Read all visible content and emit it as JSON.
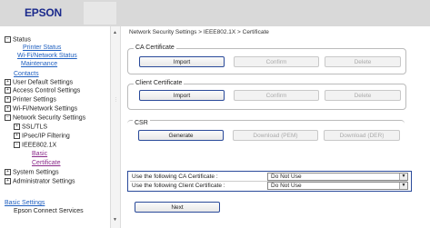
{
  "header": {
    "logo": "EPSON"
  },
  "sidebar": {
    "status": "Status",
    "printer_status": "Printer Status",
    "wifi_status": "Wi-Fi/Network Status",
    "maintenance": "Maintenance",
    "contacts": "Contacts",
    "user_default": "User Default Settings",
    "access_control": "Access Control Settings",
    "printer_settings": "Printer Settings",
    "wifi_settings": "Wi-Fi/Network Settings",
    "network_security": "Network Security Settings",
    "ssl_tls": "SSL/TLS",
    "ipsec": "IPsec/IP Filtering",
    "ieee": "IEEE802.1X",
    "basic": "Basic",
    "certificate": "Certificate",
    "system_settings": "System Settings",
    "admin_settings": "Administrator Settings",
    "basic_settings": "Basic Settings",
    "epson_connect": "Epson Connect Services"
  },
  "main": {
    "breadcrumb": "Network Security Settings > IEEE802.1X > Certificate",
    "ca_cert": {
      "label": "CA Certificate",
      "import": "Import",
      "confirm": "Confirm",
      "delete": "Delete"
    },
    "client_cert": {
      "label": "Client Certificate",
      "import": "Import",
      "confirm": "Confirm",
      "delete": "Delete"
    },
    "csr": {
      "label": "CSR",
      "generate": "Generate",
      "download_pem": "Download (PEM)",
      "download_der": "Download (DER)"
    },
    "use_ca": {
      "label": "Use the following CA Certificate :",
      "value": "Do Not Use"
    },
    "use_client": {
      "label": "Use the following Client Certificate :",
      "value": "Do Not Use"
    },
    "next": "Next"
  }
}
